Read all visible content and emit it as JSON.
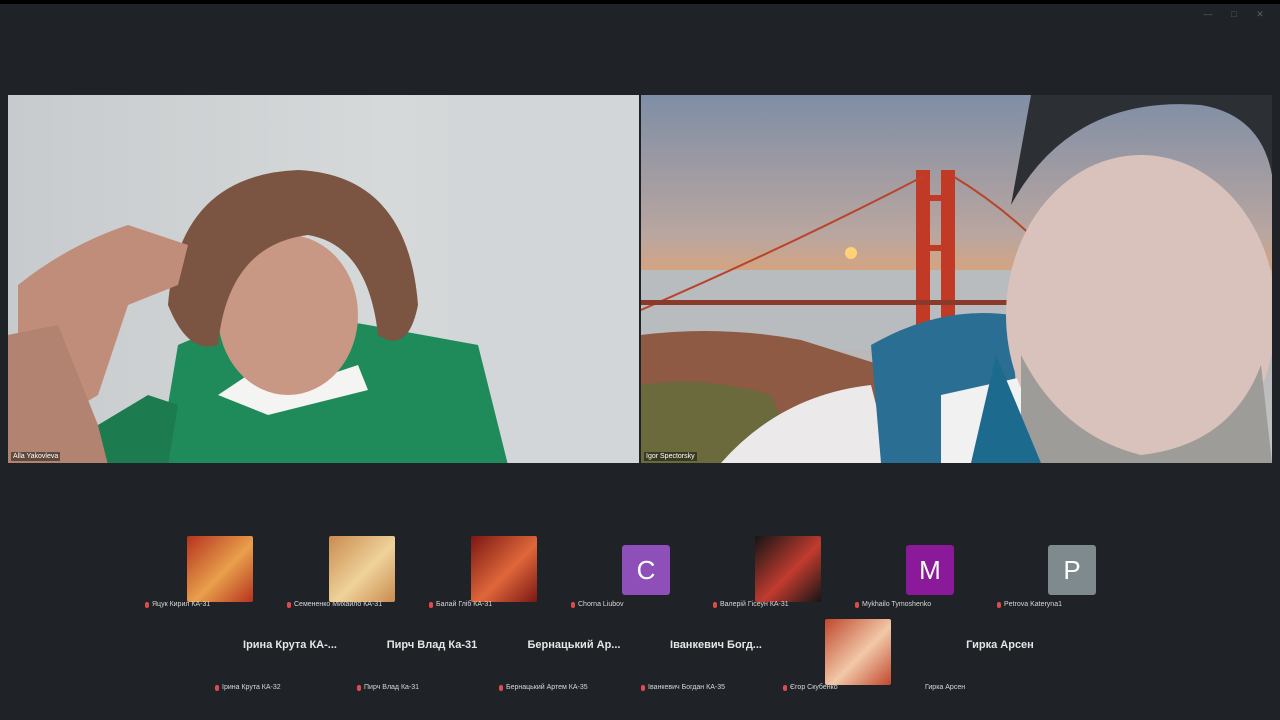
{
  "videos": [
    {
      "name": "Alla Yakovleva"
    },
    {
      "name": "Igor Spectorsky"
    }
  ],
  "participants_row1": [
    {
      "label": "Яцук Кирил КА-31",
      "type": "thumb",
      "colors": [
        "#b5321f",
        "#e9a04c"
      ]
    },
    {
      "label": "Семененко Михайло КА-31",
      "type": "thumb",
      "colors": [
        "#c98b4f",
        "#efd29a"
      ]
    },
    {
      "label": "Балай Гліб КА-31",
      "type": "thumb",
      "colors": [
        "#7a1713",
        "#e0673a"
      ]
    },
    {
      "label": "Chorna Liubov",
      "type": "avatar",
      "letter": "C",
      "color": "#8e4fb8"
    },
    {
      "label": "Валерій Гісеун КА-31",
      "type": "thumb",
      "colors": [
        "#151515",
        "#c23b2f"
      ]
    },
    {
      "label": "Mykhailo Tymoshenko",
      "type": "avatar",
      "letter": "M",
      "color": "#8a1a9a"
    },
    {
      "label": "Petrova Kateryna1",
      "type": "avatar",
      "letter": "P",
      "color": "#7e8a8d"
    }
  ],
  "participants_row2": [
    {
      "label": "Ірина Крута КА-32",
      "type": "name",
      "bigname": "Ірина  Крута  КА-..."
    },
    {
      "label": "Пирч Влад Ка-31",
      "type": "name",
      "bigname": "Пирч Влад Ка-31"
    },
    {
      "label": "Бернацький Артем КА-35",
      "type": "name",
      "bigname": "Бернацький  Ар..."
    },
    {
      "label": "Іванкевич Богдан КА-35",
      "type": "name",
      "bigname": "Іванкевич  Богд..."
    },
    {
      "label": "Єгор Скубенко",
      "type": "thumb",
      "colors": [
        "#c0472e",
        "#f2c9a8"
      ]
    },
    {
      "label": "Гирка Арсен",
      "type": "name",
      "bigname": "Гирка Арсен",
      "nomic": true
    }
  ]
}
